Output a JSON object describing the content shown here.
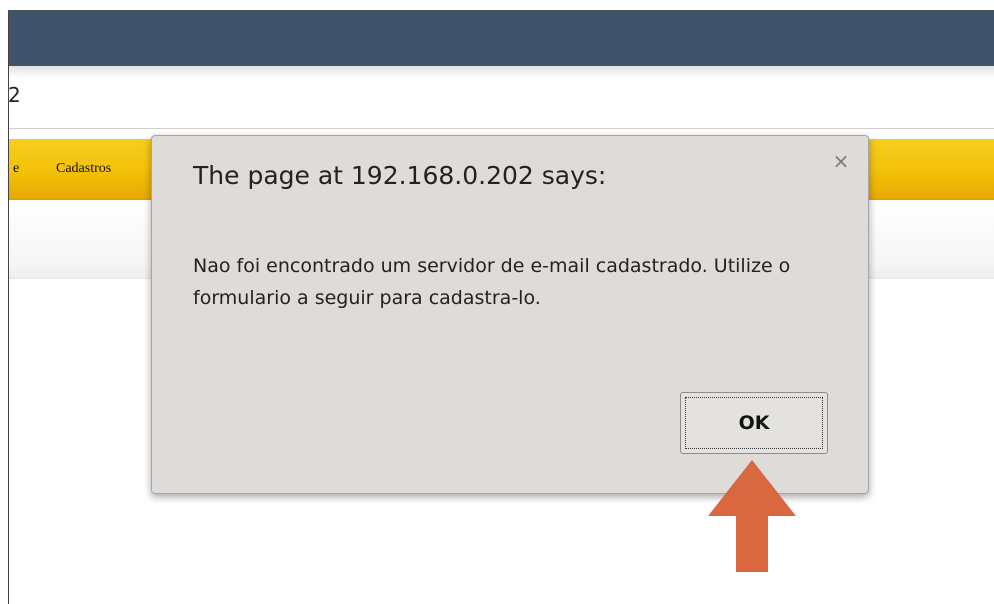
{
  "page": {
    "address_fragment": "2"
  },
  "nav": {
    "partial_item": "e",
    "item": "Cadastros"
  },
  "dialog": {
    "title": "The page at 192.168.0.202 says:",
    "close_glyph": "×",
    "message": "Nao foi encontrado um servidor de e-mail cadastrado. Utilize o formulario a seguir para cadastra-lo.",
    "ok_label": "OK"
  },
  "annotation": {
    "arrow_icon": "up-arrow-icon",
    "arrow_color": "#d9673f"
  },
  "colors": {
    "topbar": "#3f546b",
    "nav": "#f3c108",
    "dialog_bg": "#dedbd8"
  }
}
